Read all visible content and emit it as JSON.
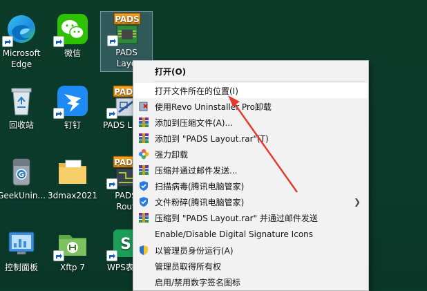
{
  "desktop": {
    "icons": [
      {
        "label_1": "Microsoft",
        "label_2": "Edge"
      },
      {
        "label_1": "微信"
      },
      {
        "label_1": "PADS",
        "label_2": "Layo"
      },
      {
        "label_1": "回收站"
      },
      {
        "label_1": "钉钉"
      },
      {
        "label_1": "PADS L"
      },
      {
        "label_1": "GeekUnin..."
      },
      {
        "label_1": "3dmax2021"
      },
      {
        "label_1": "PADS",
        "label_2": "Rout"
      },
      {
        "label_1": "控制面板"
      },
      {
        "label_1": "Xftp 7"
      },
      {
        "label_1": "WPS表"
      }
    ]
  },
  "context_menu": {
    "items": [
      {
        "label": "打开(O)",
        "icon": "none"
      },
      {
        "label": "打开文件所在的位置(I)",
        "icon": "none"
      },
      {
        "label": "使用Revo Uninstaller Pro卸载",
        "icon": "revo-uninstaller-icon"
      },
      {
        "label": "添加到压缩文件(A)...",
        "icon": "winrar-icon"
      },
      {
        "label": "添加到 \"PADS Layout.rar\"(T)",
        "icon": "winrar-icon"
      },
      {
        "label": "强力卸载",
        "icon": "flower-icon"
      },
      {
        "label": "压缩并通过邮件发送...",
        "icon": "winrar-icon"
      },
      {
        "label": "扫描病毒(腾讯电脑管家)",
        "icon": "tencent-shield-icon"
      },
      {
        "label": "文件粉碎(腾讯电脑管家)",
        "icon": "tencent-shield-icon"
      },
      {
        "label": "压缩到 \"PADS Layout.rar\" 并通过邮件发送",
        "icon": "winrar-icon"
      },
      {
        "label": "Enable/Disable Digital Signature Icons",
        "icon": "none"
      },
      {
        "label": "以管理员身份运行(A)",
        "icon": "uac-shield-icon"
      },
      {
        "label": "管理员取得所有权",
        "icon": "none"
      },
      {
        "label": "启用/禁用数字签名图标",
        "icon": "none"
      }
    ]
  },
  "colors": {
    "desktop_bg": "#0b3a2b",
    "menu_bg": "#f2f2f2",
    "menu_highlight": "#ffffff",
    "annotation_arrow": "#e53b2f"
  }
}
